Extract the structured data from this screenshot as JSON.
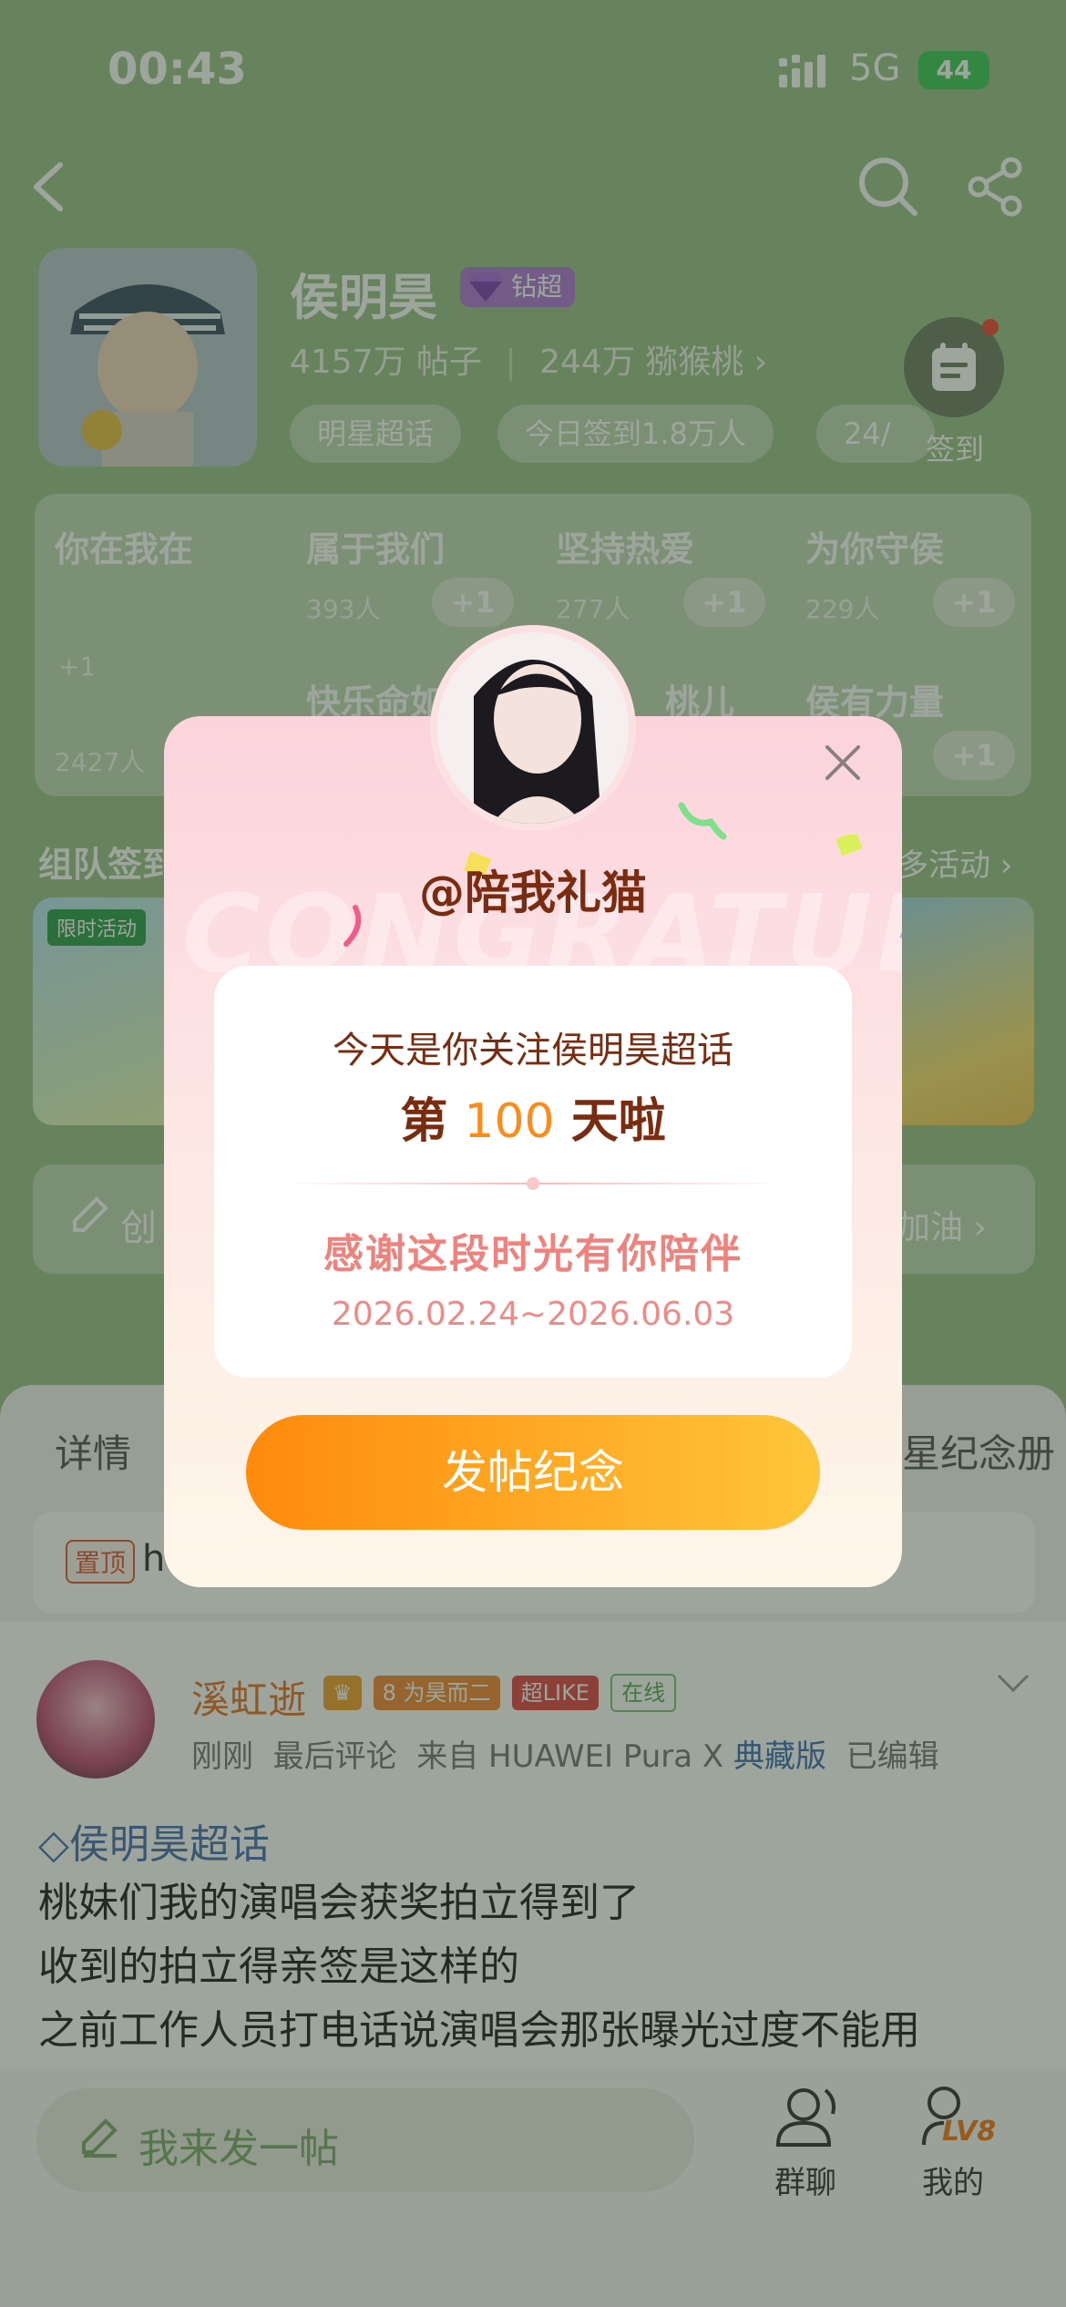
{
  "status_bar": {
    "time": "00:43",
    "network": "5G",
    "battery": "44"
  },
  "topic": {
    "name": "侯明昊",
    "super_badge": "钻超",
    "posts": "4157万 帖子",
    "fans": "244万 猕猴桃",
    "chips": [
      "明星超话",
      "今日签到1.8万人",
      "24/"
    ],
    "checkin_label": "签到"
  },
  "groups": {
    "hot_title": "你在我在",
    "hot_plus": "+1",
    "hot_count": "2427人",
    "cells": [
      {
        "name": "属于我们",
        "count": "393人",
        "plus": "+1"
      },
      {
        "name": "坚持热爱",
        "count": "277人",
        "plus": "+1"
      },
      {
        "name": "为你守侯",
        "count": "229人",
        "plus": "+1"
      },
      {
        "name": "快乐命如",
        "count": "",
        "plus": ""
      },
      {
        "name": "桃儿",
        "count": "",
        "plus": ""
      },
      {
        "name": "侯有力量",
        "count": "",
        "plus": "+1"
      }
    ]
  },
  "section": {
    "title": "组队签到",
    "more": "多活动",
    "limit_tag": "限时活动"
  },
  "create": {
    "label": "创",
    "cheer": "加油"
  },
  "tabs": {
    "left": "详情",
    "right": "星纪念册"
  },
  "pinned": {
    "tag": "置顶",
    "text": "h"
  },
  "post": {
    "user": "溪虹逝",
    "badge_level": "8",
    "badge_fan": "为昊而二",
    "badge_like": "超LIKE",
    "badge_online": "在线",
    "meta_time": "刚刚",
    "meta_comment": "最后评论",
    "meta_source": "来自 HUAWEI Pura X",
    "meta_edition": "典藏版",
    "meta_edited": "已编辑",
    "topic": "侯明昊超话",
    "lines": [
      "桃妹们我的演唱会获奖拍立得到了",
      "收到的拍立得亲签是这样的",
      "之前工作人员打电话说演唱会那张曝光过度不能用"
    ]
  },
  "bottom": {
    "post_placeholder": "我来发一帖",
    "group_chat": "群聊",
    "mine": "我的",
    "level": "LV8"
  },
  "modal": {
    "bg_text": "CONGRATULATE",
    "username": "@陪我礼猫",
    "line1": "今天是你关注侯明昊超话",
    "day_prefix": "第",
    "day_number": "100",
    "day_suffix": "天啦",
    "thanks": "感谢这段时光有你陪伴",
    "date_range": "2026.02.24~2026.06.03",
    "cta": "发帖纪念"
  },
  "colors": {
    "accent_orange": "#ff8a1a",
    "title_brown": "#7a2c11",
    "pink_text": "#f0827e",
    "green_bg": "#9bc28e"
  }
}
